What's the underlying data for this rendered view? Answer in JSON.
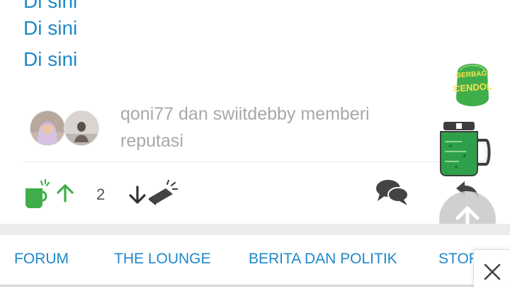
{
  "post": {
    "links": [
      "Di sini",
      "Di sini",
      "Di sini"
    ],
    "reputation_text": "qoni77 dan swiitdebby memberi reputasi"
  },
  "actions": {
    "vote_count": "2"
  },
  "promo": {
    "line1": "BERBAGI",
    "line2": "CENDOL"
  },
  "nav": {
    "items": [
      "FORUM",
      "THE LOUNGE",
      "BERITA DAN POLITIK",
      "STOR"
    ]
  },
  "colors": {
    "link": "#1e88c9",
    "green": "#3fae4a",
    "muted": "#a8a8a8"
  }
}
